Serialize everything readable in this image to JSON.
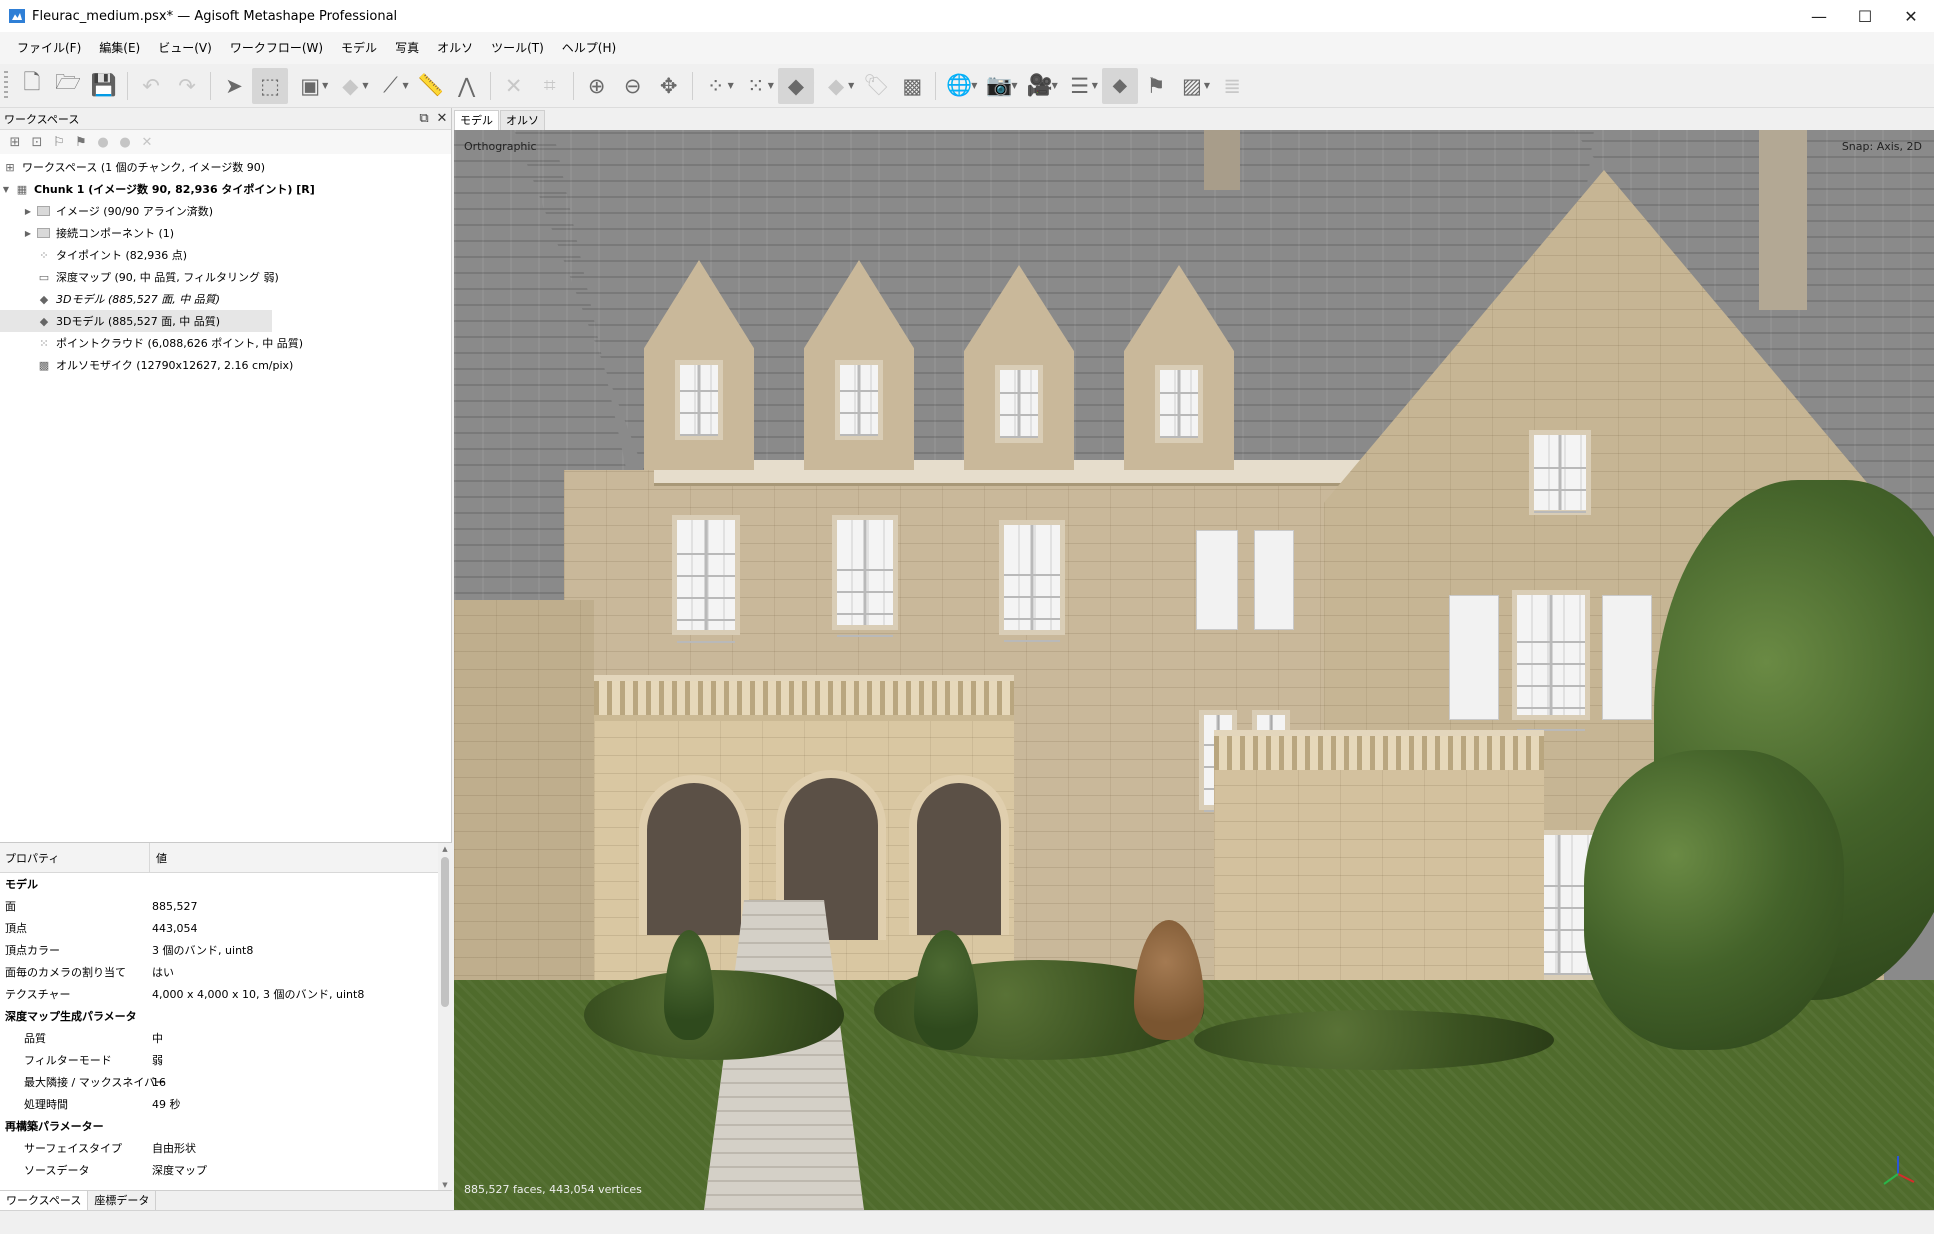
{
  "window": {
    "title": "Fleurac_medium.psx* — Agisoft Metashape Professional",
    "minimize": "—",
    "maximize": "☐",
    "close": "✕"
  },
  "menu": [
    "ファイル(F)",
    "編集(E)",
    "ビュー(V)",
    "ワークフロー(W)",
    "モデル",
    "写真",
    "オルソ",
    "ツール(T)",
    "ヘルプ(H)"
  ],
  "workspace": {
    "title": "ワークスペース",
    "items": [
      {
        "label": "ワークスペース (1 個のチャンク, イメージ数 90)"
      },
      {
        "label": "Chunk 1 (イメージ数 90, 82,936 タイポイント) [R]"
      },
      {
        "label": "イメージ (90/90 アライン済数)"
      },
      {
        "label": "接続コンポーネント (1)"
      },
      {
        "label": "タイポイント (82,936 点)"
      },
      {
        "label": "深度マップ (90, 中 品質, フィルタリング 弱)"
      },
      {
        "label": "3Dモデル (885,527 面, 中 品質)"
      },
      {
        "label": "3Dモデル (885,527 面, 中 品質)"
      },
      {
        "label": "ポイントクラウド (6,088,626 ポイント, 中 品質)"
      },
      {
        "label": "オルソモザイク (12790x12627, 2.16 cm/pix)"
      }
    ]
  },
  "properties": {
    "col_property": "プロパティ",
    "col_value": "値",
    "group_model": "モデル",
    "rows_model": [
      {
        "k": "面",
        "v": "885,527"
      },
      {
        "k": "頂点",
        "v": "443,054"
      },
      {
        "k": "頂点カラー",
        "v": "3 個のバンド, uint8"
      },
      {
        "k": "面毎のカメラの割り当て",
        "v": "はい"
      },
      {
        "k": "テクスチャー",
        "v": "4,000 x 4,000 x 10, 3 個のバンド, uint8"
      }
    ],
    "group_depth": "深度マップ生成パラメータ",
    "rows_depth": [
      {
        "k": "品質",
        "v": "中"
      },
      {
        "k": "フィルターモード",
        "v": "弱"
      },
      {
        "k": "最大隣接 / マックスネイバー",
        "v": "16"
      },
      {
        "k": "処理時間",
        "v": "49 秒"
      }
    ],
    "group_recon": "再構築パラメーター",
    "rows_recon": [
      {
        "k": "サーフェイスタイプ",
        "v": "自由形状"
      },
      {
        "k": "ソースデータ",
        "v": "深度マップ"
      }
    ]
  },
  "bottom_tabs": [
    "ワークスペース",
    "座標データ"
  ],
  "view_tabs": [
    "モデル",
    "オルソ"
  ],
  "viewport": {
    "projection": "Orthographic",
    "snap": "Snap: Axis, 2D",
    "stats": "885,527 faces, 443,054 vertices"
  }
}
